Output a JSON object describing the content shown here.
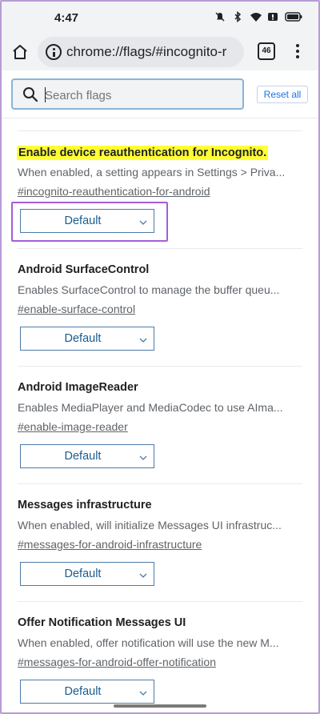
{
  "status_bar": {
    "time": "4:47",
    "icons": [
      "mute-icon",
      "bluetooth-icon",
      "wifi-icon",
      "alert-icon",
      "battery-icon"
    ]
  },
  "toolbar": {
    "url_scheme": "chrome://",
    "url_path": "flags/#incognito-r",
    "tab_count": "46"
  },
  "search": {
    "placeholder": "Search flags",
    "reset_label": "Reset all"
  },
  "flags": [
    {
      "title": "Enable device reauthentication for Incognito.",
      "description": "When enabled, a setting appears in Settings > Priva...",
      "link": "#incognito-reauthentication-for-android",
      "select": "Default",
      "highlighted": true
    },
    {
      "title": "Android SurfaceControl",
      "description": "Enables SurfaceControl to manage the buffer queu...",
      "link": "#enable-surface-control",
      "select": "Default"
    },
    {
      "title": "Android ImageReader",
      "description": "Enables MediaPlayer and MediaCodec to use AIma...",
      "link": "#enable-image-reader",
      "select": "Default"
    },
    {
      "title": "Messages infrastructure",
      "description": "When enabled, will initialize Messages UI infrastruc...",
      "link": "#messages-for-android-infrastructure",
      "select": "Default"
    },
    {
      "title": "Offer Notification Messages UI",
      "description": "When enabled, offer notification will use the new M...",
      "link": "#messages-for-android-offer-notification",
      "select": "Default"
    }
  ],
  "colors": {
    "highlight": "#ffff33",
    "accent": "#1a73e8",
    "annotation_box": "#a45ed6"
  }
}
